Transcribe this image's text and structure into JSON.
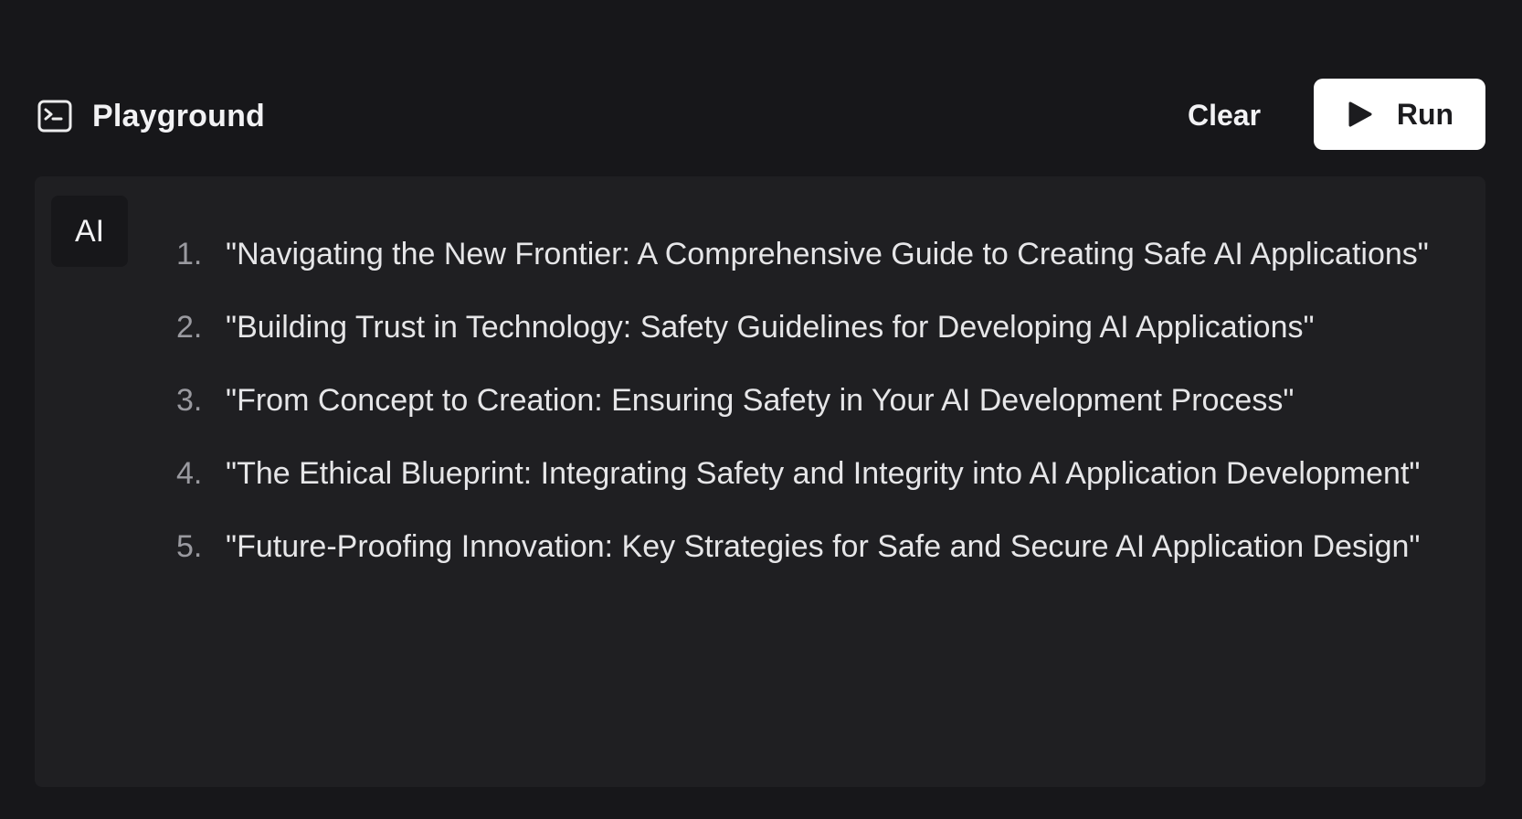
{
  "header": {
    "title": "Playground",
    "icon": "terminal-icon",
    "clear_label": "Clear",
    "run_label": "Run",
    "run_icon": "play-icon"
  },
  "output": {
    "badge": "AI",
    "items": [
      {
        "number": "1.",
        "text": "\"Navigating the New Frontier: A Comprehensive Guide to Creating Safe AI Applications\""
      },
      {
        "number": "2.",
        "text": "\"Building Trust in Technology: Safety Guidelines for Developing AI Applications\""
      },
      {
        "number": "3.",
        "text": "\"From Concept to Creation: Ensuring Safety in Your AI Development Process\""
      },
      {
        "number": "4.",
        "text": "\"The Ethical Blueprint: Integrating Safety and Integrity into AI Application Development\""
      },
      {
        "number": "5.",
        "text": "\"Future-Proofing Innovation: Key Strategies for Safe and Secure AI Application Design\""
      }
    ]
  },
  "colors": {
    "background": "#17171a",
    "panel": "#1f1f22",
    "run_button": "#ffffff",
    "text": "#e6e6e8",
    "muted_text": "#9a9aa0"
  }
}
